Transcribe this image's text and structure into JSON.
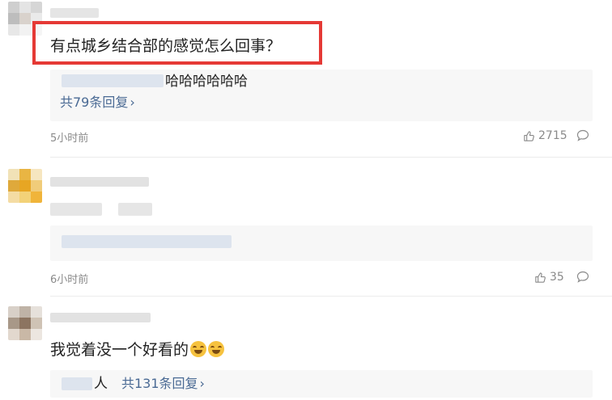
{
  "comments": [
    {
      "text": "有点城乡结合部的感觉怎么回事？",
      "reply_preview_text": "哈哈哈哈哈哈",
      "reply_more_label": "共79条回复",
      "time": "5小时前",
      "likes": "2715"
    },
    {
      "text": "",
      "reply_more_label": "",
      "time": "6小时前",
      "likes": "35"
    },
    {
      "text": "我觉着没一个好看的",
      "reply_preview_text": "人",
      "reply_more_label": "共131条回复",
      "time": "",
      "likes": ""
    }
  ],
  "colors": {
    "highlight_border": "#e53935",
    "link": "#4a6a94",
    "meta": "#8a8a8a",
    "reply_bg": "#f7f7f7"
  }
}
